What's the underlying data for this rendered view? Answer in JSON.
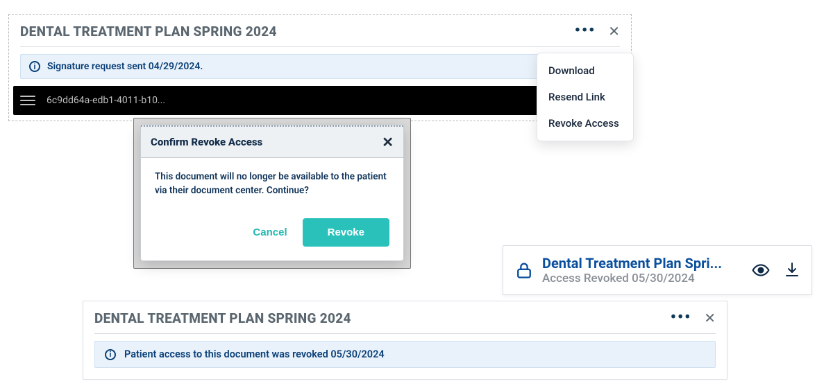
{
  "panel1": {
    "title": "DENTAL TREATMENT PLAN SPRING 2024",
    "info_message": "Signature request sent 04/29/2024.",
    "doc_filename": "6c9dd64a-edb1-4011-b10...",
    "menu": {
      "download": "Download",
      "resend": "Resend Link",
      "revoke": "Revoke Access"
    }
  },
  "modal": {
    "title": "Confirm Revoke Access",
    "body": "This document will no longer be available to the patient via their document center. Continue?",
    "cancel": "Cancel",
    "confirm": "Revoke"
  },
  "tile": {
    "title": "Dental Treatment Plan Spri...",
    "subtitle": "Access Revoked 05/30/2024"
  },
  "panel2": {
    "title": "DENTAL TREATMENT PLAN SPRING 2024",
    "info_message": "Patient access to this document was revoked 05/30/2024"
  },
  "colors": {
    "accent": "#2bc1bb",
    "link": "#0a4f9e",
    "info_bg": "#e9f2fb",
    "heading": "#5b6770"
  }
}
